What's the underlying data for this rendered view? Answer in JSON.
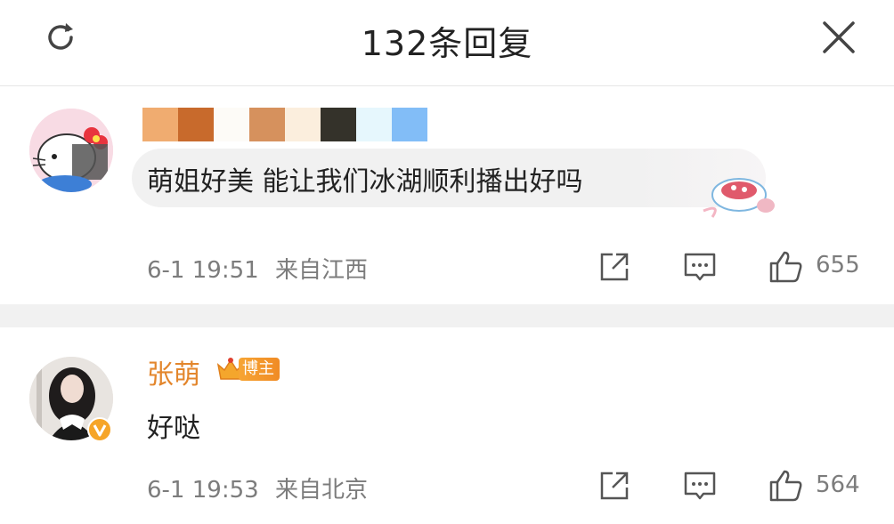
{
  "header": {
    "title": "132条回复"
  },
  "comments": [
    {
      "content": "萌姐好美 能让我们冰湖顺利播出好吗",
      "time": "6-1 19:51",
      "location": "来自江西",
      "likes": "655"
    },
    {
      "author": "张萌",
      "badge": "博主",
      "content": "好哒",
      "time": "6-1 19:53",
      "location": "来自北京",
      "likes": "564"
    }
  ],
  "colors": {
    "author_orange": "#e3862c",
    "meta_gray": "#7c7c7c",
    "separator": "#f1f1f1"
  },
  "icons": [
    "refresh-icon",
    "close-icon",
    "share-icon",
    "comment-icon",
    "thumbs-up-icon",
    "crown-icon",
    "verified-icon"
  ]
}
